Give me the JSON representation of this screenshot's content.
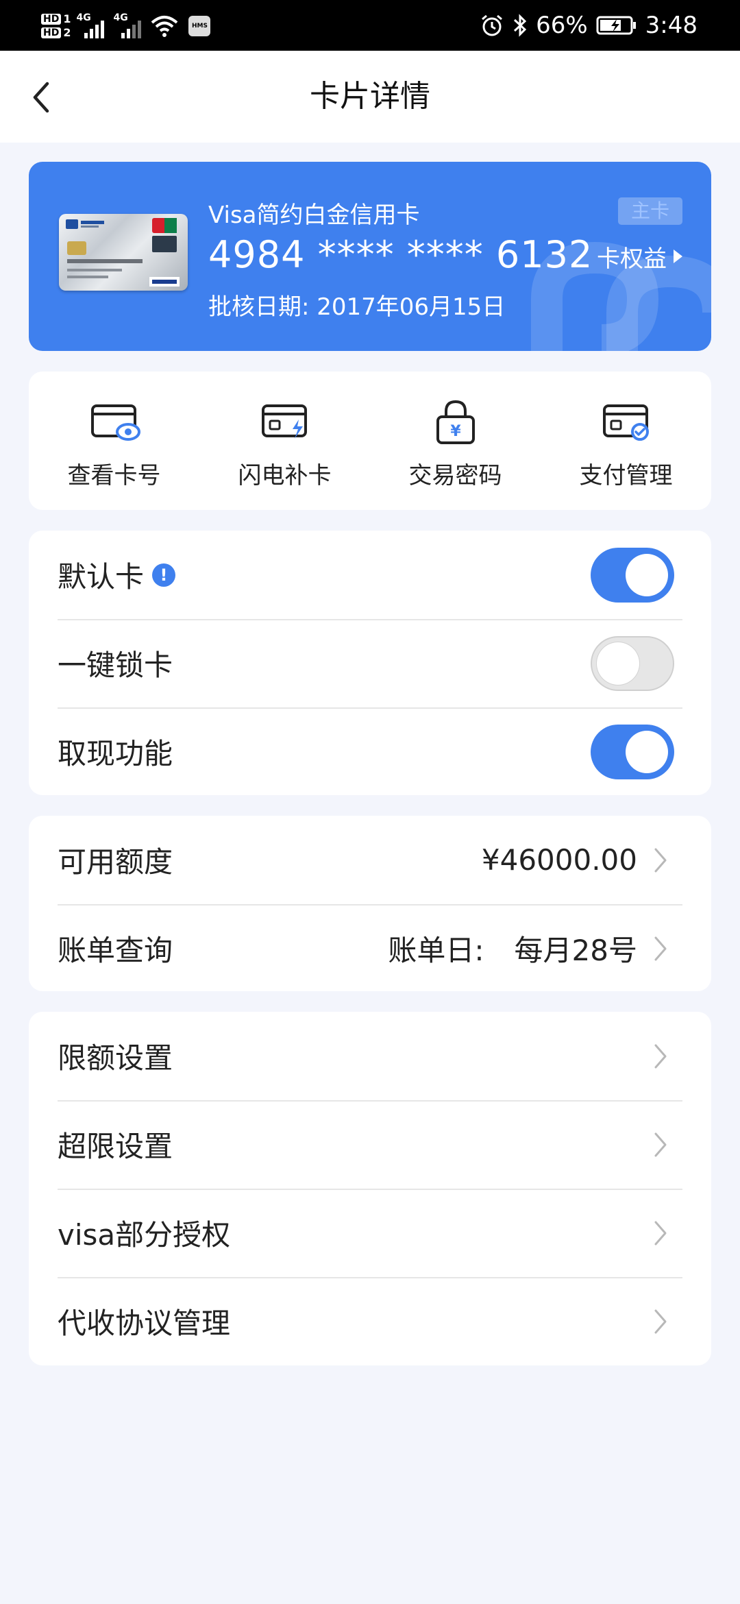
{
  "status_bar": {
    "sim1": "HD",
    "sim1_slot": "1",
    "sim2": "HD",
    "sim2_slot": "2",
    "net1": "4G",
    "net2": "4G",
    "hms": "HMS",
    "battery": "66%",
    "time": "3:48",
    "icons": [
      "alarm-icon",
      "bluetooth-icon",
      "battery-charging-icon",
      "wifi-icon"
    ]
  },
  "nav": {
    "title": "卡片详情",
    "back_icon": "back-chevron-icon"
  },
  "card": {
    "name": "Visa简约白金信用卡",
    "number": "4984 **** **** 6132",
    "approval_date": "批核日期: 2017年06月15日",
    "badge": "主卡",
    "benefits": "卡权益",
    "accent_color": "#3f80ee"
  },
  "quick_actions": [
    {
      "label": "查看卡号",
      "icon": "card-eye-icon"
    },
    {
      "label": "闪电补卡",
      "icon": "card-lightning-icon"
    },
    {
      "label": "交易密码",
      "icon": "lock-yuan-icon"
    },
    {
      "label": "支付管理",
      "icon": "card-check-icon"
    }
  ],
  "toggles": [
    {
      "label": "默认卡",
      "info": "!",
      "state": "on"
    },
    {
      "label": "一键锁卡",
      "state": "off"
    },
    {
      "label": "取现功能",
      "state": "on"
    }
  ],
  "account": {
    "limit_label": "可用额度",
    "limit_value": "¥46000.00",
    "bill_label": "账单查询",
    "bill_prefix": "账单日:",
    "bill_day": "每月28号"
  },
  "settings": [
    {
      "label": "限额设置"
    },
    {
      "label": "超限设置"
    },
    {
      "label": "visa部分授权"
    },
    {
      "label": "代收协议管理"
    }
  ]
}
